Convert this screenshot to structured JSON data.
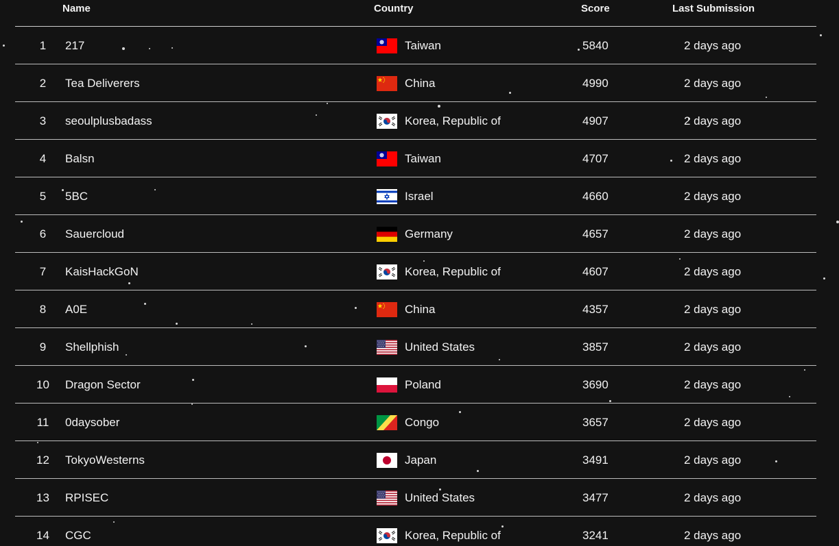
{
  "columns": {
    "name": "Name",
    "country": "Country",
    "score": "Score",
    "last_submission": "Last Submission"
  },
  "rows": [
    {
      "rank": "1",
      "name": "217",
      "country": "Taiwan",
      "flag": "taiwan-flag-icon",
      "score": "5840",
      "last": "2 days ago"
    },
    {
      "rank": "2",
      "name": "Tea Deliverers",
      "country": "China",
      "flag": "china-flag-icon",
      "score": "4990",
      "last": "2 days ago"
    },
    {
      "rank": "3",
      "name": "seoulplusbadass",
      "country": "Korea, Republic of",
      "flag": "south-korea-flag-icon",
      "score": "4907",
      "last": "2 days ago"
    },
    {
      "rank": "4",
      "name": "Balsn",
      "country": "Taiwan",
      "flag": "taiwan-flag-icon",
      "score": "4707",
      "last": "2 days ago"
    },
    {
      "rank": "5",
      "name": "5BC",
      "country": "Israel",
      "flag": "israel-flag-icon",
      "score": "4660",
      "last": "2 days ago"
    },
    {
      "rank": "6",
      "name": "Sauercloud",
      "country": "Germany",
      "flag": "germany-flag-icon",
      "score": "4657",
      "last": "2 days ago"
    },
    {
      "rank": "7",
      "name": "KaisHackGoN",
      "country": "Korea, Republic of",
      "flag": "south-korea-flag-icon",
      "score": "4607",
      "last": "2 days ago"
    },
    {
      "rank": "8",
      "name": "A0E",
      "country": "China",
      "flag": "china-flag-icon",
      "score": "4357",
      "last": "2 days ago"
    },
    {
      "rank": "9",
      "name": "Shellphish",
      "country": "United States",
      "flag": "united-states-flag-icon",
      "score": "3857",
      "last": "2 days ago"
    },
    {
      "rank": "10",
      "name": "Dragon Sector",
      "country": "Poland",
      "flag": "poland-flag-icon",
      "score": "3690",
      "last": "2 days ago"
    },
    {
      "rank": "11",
      "name": "0daysober",
      "country": "Congo",
      "flag": "congo-flag-icon",
      "score": "3657",
      "last": "2 days ago"
    },
    {
      "rank": "12",
      "name": "TokyoWesterns",
      "country": "Japan",
      "flag": "japan-flag-icon",
      "score": "3491",
      "last": "2 days ago"
    },
    {
      "rank": "13",
      "name": "RPISEC",
      "country": "United States",
      "flag": "united-states-flag-icon",
      "score": "3477",
      "last": "2 days ago"
    },
    {
      "rank": "14",
      "name": "CGC",
      "country": "Korea, Republic of",
      "flag": "south-korea-flag-icon",
      "score": "3241",
      "last": "2 days ago"
    }
  ],
  "colors": {
    "background": "#131313",
    "text": "#f2f2f2",
    "divider": "#bdbdbd"
  }
}
